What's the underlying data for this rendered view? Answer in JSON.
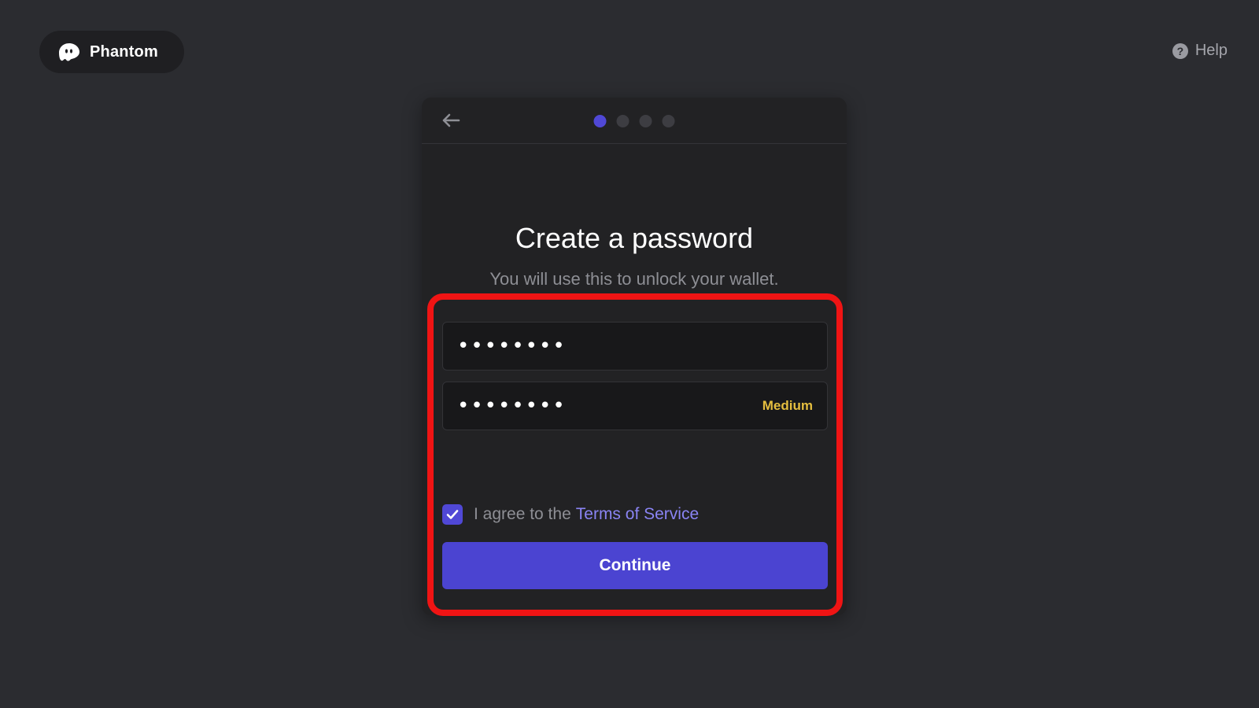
{
  "header": {
    "brand_name": "Phantom",
    "brand_icon": "phantom-ghost-logo",
    "help_label": "Help",
    "help_icon": "question-circle-icon"
  },
  "onboarding": {
    "back_icon": "arrow-left-icon",
    "steps": {
      "total": 4,
      "current": 1
    },
    "title": "Create a password",
    "subtitle": "You will use this to unlock your wallet.",
    "password_field": {
      "value": "••••••••",
      "type": "password"
    },
    "confirm_field": {
      "value": "••••••••",
      "type": "password",
      "strength_label": "Medium"
    },
    "terms": {
      "checked": true,
      "prefix": "I agree to the",
      "link_text": "Terms of Service"
    },
    "continue_label": "Continue"
  },
  "colors": {
    "accent": "#4b44d1",
    "strength_medium": "#e5be3f",
    "highlight": "#f01414",
    "background": "#2b2c30"
  }
}
